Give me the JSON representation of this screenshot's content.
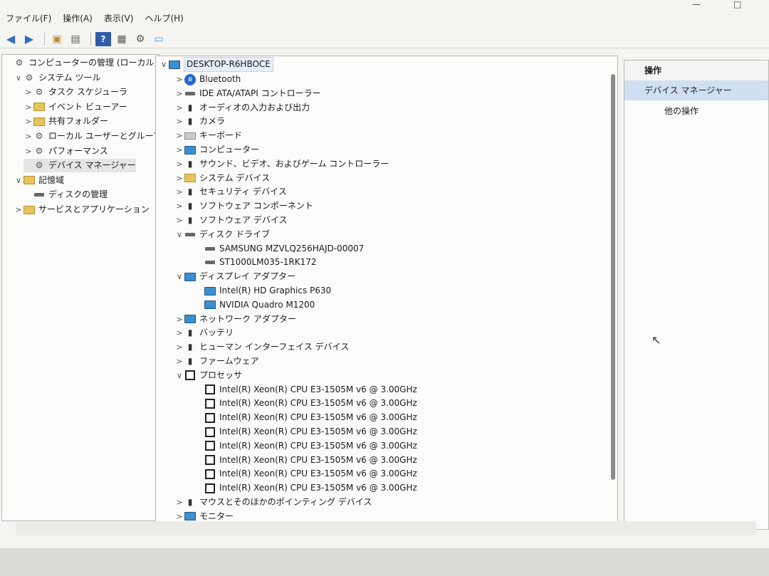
{
  "menu": [
    "ファイル(F)",
    "操作(A)",
    "表示(V)",
    "ヘルプ(H)"
  ],
  "window_controls": [
    "—",
    "□"
  ],
  "toolbar_icons": [
    "back-arrow-icon",
    "forward-arrow-icon",
    "folder-up-icon",
    "properties-icon",
    "help-icon",
    "view-icon",
    "device-scan-icon",
    "monitor-icon"
  ],
  "left_tree": [
    {
      "label": "コンピューターの管理 (ローカル)",
      "chev": "",
      "icon": "gear"
    },
    {
      "label": "システム ツール",
      "chev": "∨",
      "icon": "gear"
    },
    {
      "label": "タスク スケジューラ",
      "chev": ">",
      "icon": "gear"
    },
    {
      "label": "イベント ビューアー",
      "chev": ">",
      "icon": "folder"
    },
    {
      "label": "共有フォルダー",
      "chev": ">",
      "icon": "folder"
    },
    {
      "label": "ローカル ユーザーとグループ",
      "chev": ">",
      "icon": "gear"
    },
    {
      "label": "パフォーマンス",
      "chev": ">",
      "icon": "gear"
    },
    {
      "label": "デバイス マネージャー",
      "chev": "",
      "icon": "gear"
    },
    {
      "label": "記憶域",
      "chev": "∨",
      "icon": "folder"
    },
    {
      "label": "ディスクの管理",
      "chev": "",
      "icon": "disk"
    },
    {
      "label": "サービスとアプリケーション",
      "chev": ">",
      "icon": "folder"
    }
  ],
  "center_root": "DESKTOP-R6HBOCE",
  "device_tree": [
    {
      "label": "Bluetooth",
      "chev": ">",
      "icon": "bt"
    },
    {
      "label": "IDE ATA/ATAPI コントローラー",
      "chev": ">",
      "icon": "disk"
    },
    {
      "label": "オーディオの入力および出力",
      "chev": ">",
      "icon": "dark"
    },
    {
      "label": "カメラ",
      "chev": ">",
      "icon": "dark"
    },
    {
      "label": "キーボード",
      "chev": ">",
      "icon": "kbd"
    },
    {
      "label": "コンピューター",
      "chev": ">",
      "icon": "mon"
    },
    {
      "label": "サウンド、ビデオ、およびゲーム コントローラー",
      "chev": ">",
      "icon": "dark"
    },
    {
      "label": "システム デバイス",
      "chev": ">",
      "icon": "folder"
    },
    {
      "label": "セキュリティ デバイス",
      "chev": ">",
      "icon": "dark"
    },
    {
      "label": "ソフトウェア コンポーネント",
      "chev": ">",
      "icon": "dark"
    },
    {
      "label": "ソフトウェア デバイス",
      "chev": ">",
      "icon": "dark"
    },
    {
      "label": "ディスク ドライブ",
      "chev": "∨",
      "icon": "disk"
    },
    {
      "label": "SAMSUNG MZVLQ256HAJD-00007",
      "chev": "",
      "icon": "disk",
      "child": true
    },
    {
      "label": "ST1000LM035-1RK172",
      "chev": "",
      "icon": "disk",
      "child": true
    },
    {
      "label": "ディスプレイ アダプター",
      "chev": "∨",
      "icon": "mon"
    },
    {
      "label": "Intel(R) HD Graphics P630",
      "chev": "",
      "icon": "mon",
      "child": true
    },
    {
      "label": "NVIDIA Quadro M1200",
      "chev": "",
      "icon": "mon",
      "child": true
    },
    {
      "label": "ネットワーク アダプター",
      "chev": ">",
      "icon": "mon"
    },
    {
      "label": "バッテリ",
      "chev": ">",
      "icon": "dark"
    },
    {
      "label": "ヒューマン インターフェイス デバイス",
      "chev": ">",
      "icon": "dark"
    },
    {
      "label": "ファームウェア",
      "chev": ">",
      "icon": "dark"
    },
    {
      "label": "プロセッサ",
      "chev": "∨",
      "icon": "chip"
    },
    {
      "label": "Intel(R) Xeon(R) CPU E3-1505M v6 @ 3.00GHz",
      "chev": "",
      "icon": "chip",
      "child": true
    },
    {
      "label": "Intel(R) Xeon(R) CPU E3-1505M v6 @ 3.00GHz",
      "chev": "",
      "icon": "chip",
      "child": true
    },
    {
      "label": "Intel(R) Xeon(R) CPU E3-1505M v6 @ 3.00GHz",
      "chev": "",
      "icon": "chip",
      "child": true
    },
    {
      "label": "Intel(R) Xeon(R) CPU E3-1505M v6 @ 3.00GHz",
      "chev": "",
      "icon": "chip",
      "child": true
    },
    {
      "label": "Intel(R) Xeon(R) CPU E3-1505M v6 @ 3.00GHz",
      "chev": "",
      "icon": "chip",
      "child": true
    },
    {
      "label": "Intel(R) Xeon(R) CPU E3-1505M v6 @ 3.00GHz",
      "chev": "",
      "icon": "chip",
      "child": true
    },
    {
      "label": "Intel(R) Xeon(R) CPU E3-1505M v6 @ 3.00GHz",
      "chev": "",
      "icon": "chip",
      "child": true
    },
    {
      "label": "Intel(R) Xeon(R) CPU E3-1505M v6 @ 3.00GHz",
      "chev": "",
      "icon": "chip",
      "child": true
    },
    {
      "label": "マウスとそのほかのポインティング デバイス",
      "chev": ">",
      "icon": "dark"
    },
    {
      "label": "モニター",
      "chev": ">",
      "icon": "mon"
    }
  ],
  "actions": {
    "header": "操作",
    "selected": "デバイス マネージャー",
    "sub": "他の操作"
  },
  "colors": {
    "selection": "#cfe0f2",
    "accent": "#2f6fc0"
  }
}
